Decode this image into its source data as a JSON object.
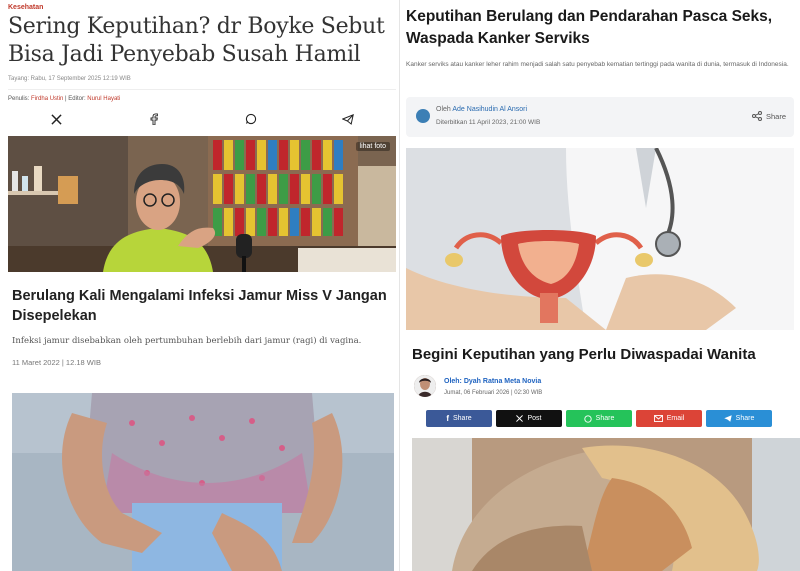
{
  "left": {
    "article1": {
      "category": "Kesehatan",
      "title": "Sering Keputihan? dr Boyke Sebut Bisa Jadi Penyebab Susah Hamil",
      "date": "Tayang: Rabu, 17 September 2025 12:19 WIB",
      "author_prefix": "Penulis:",
      "author": "Firdha Ustin",
      "editor_prefix": "| Editor:",
      "editor": "Nurul Hayati",
      "share_icons": [
        "x-icon",
        "facebook-icon",
        "whatsapp-icon",
        "telegram-icon"
      ],
      "photo_link": "lihat foto"
    },
    "article2": {
      "title": "Berulang Kali Mengalami Infeksi Jamur Miss V Jangan Disepelekan",
      "summary": "Infeksi jamur disebabkan oleh pertumbuhan berlebih dari jamur (ragi) di vagina.",
      "date": "11 Maret 2022 | 12.18 WIB"
    }
  },
  "right": {
    "article3": {
      "title": "Keputihan Berulang dan Pendarahan Pasca Seks, Waspada Kanker Serviks",
      "summary": "Kanker serviks atau kanker leher rahim menjadi salah satu penyebab kematian tertinggi pada wanita di dunia, termasuk di Indonesia.",
      "by_prefix": "Oleh",
      "author": "Ade Nasihudin Al Ansori",
      "date": "Diterbitkan 11 April 2023, 21:00 WIB",
      "share_label": "Share"
    },
    "article4": {
      "title": "Begini Keputihan yang Perlu Diwaspadai Wanita",
      "author": "Oleh: Dyah Ratna Meta Novia",
      "date": "Jumat, 06 Februari 2026 | 02:30 WIB",
      "buttons": [
        {
          "label": "Share",
          "icon": "facebook-icon",
          "color": "#3b5998"
        },
        {
          "label": "Post",
          "icon": "x-icon",
          "color": "#111111"
        },
        {
          "label": "Share",
          "icon": "whatsapp-icon",
          "color": "#25c35a"
        },
        {
          "label": "Email",
          "icon": "email-icon",
          "color": "#dc4437"
        },
        {
          "label": "Share",
          "icon": "telegram-icon",
          "color": "#2a8fd6"
        }
      ]
    }
  },
  "colors": {
    "accent_red": "#c0392b",
    "link_blue": "#2a6bb0"
  }
}
